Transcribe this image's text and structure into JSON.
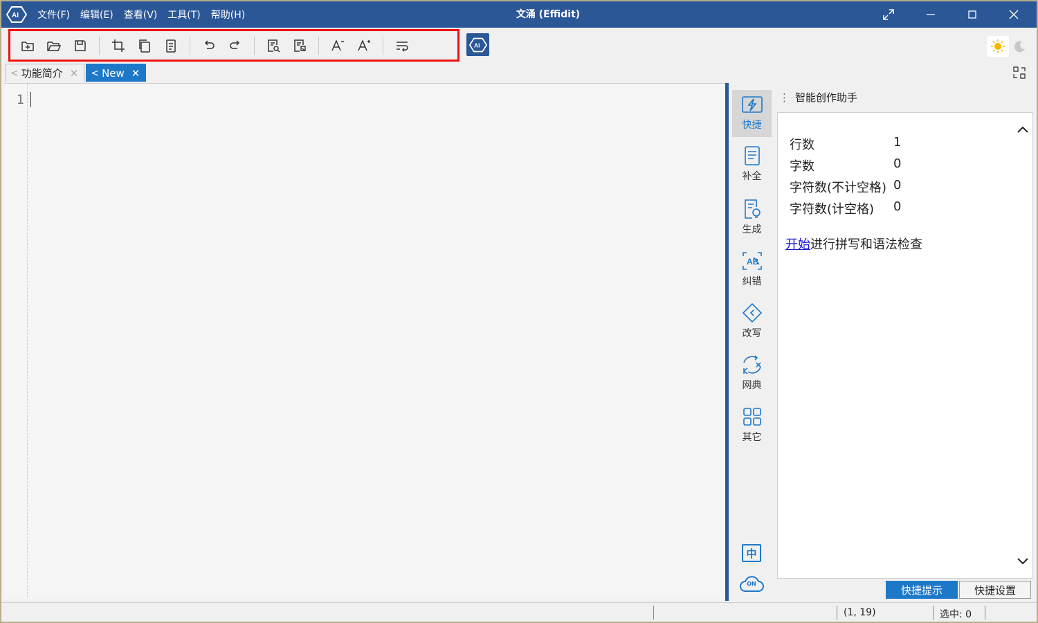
{
  "window": {
    "title": "文涌 (Effidit)",
    "menu": [
      "文件(F)",
      "编辑(E)",
      "查看(V)",
      "工具(T)",
      "帮助(H)"
    ]
  },
  "toolbar": {
    "buttons": [
      "new-file-icon",
      "open-folder-icon",
      "save-icon",
      "crop-icon",
      "copy-icon",
      "paste-icon",
      "undo-icon",
      "redo-icon",
      "find-icon",
      "replace-icon",
      "decrease-font-icon",
      "increase-font-icon",
      "word-wrap-icon"
    ]
  },
  "tabs": [
    {
      "arrow": "<",
      "label": "功能简介",
      "close": "✕",
      "active": false
    },
    {
      "arrow": "<",
      "label": "New",
      "close": "✕",
      "active": true
    }
  ],
  "editor": {
    "line_numbers": [
      "1"
    ]
  },
  "sidebar": {
    "items": [
      {
        "label": "快捷",
        "icon": "lightning-icon"
      },
      {
        "label": "补全",
        "icon": "document-complete-icon"
      },
      {
        "label": "生成",
        "icon": "document-generate-icon"
      },
      {
        "label": "纠错",
        "icon": "spell-check-icon"
      },
      {
        "label": "改写",
        "icon": "rewrite-icon"
      },
      {
        "label": "网典",
        "icon": "dictionary-icon"
      },
      {
        "label": "其它",
        "icon": "grid-icon"
      }
    ],
    "lang_badge": "中",
    "cloud_badge": "ON"
  },
  "panel": {
    "title": "智能创作助手",
    "stats": [
      {
        "label": "行数",
        "value": "1"
      },
      {
        "label": "字数",
        "value": "0"
      },
      {
        "label": "字符数(不计空格)",
        "value": "0"
      },
      {
        "label": "字符数(计空格)",
        "value": "0"
      }
    ],
    "check_link": "开始",
    "check_rest": "进行拼写和语法检查",
    "bottom_tabs": [
      "快捷提示",
      "快捷设置"
    ]
  },
  "status": {
    "position": "(1, 19)",
    "selection": "选中: 0"
  },
  "colors": {
    "titlebar": "#2b5797",
    "accent": "#1e78c8",
    "highlight_border": "#ee1111"
  }
}
